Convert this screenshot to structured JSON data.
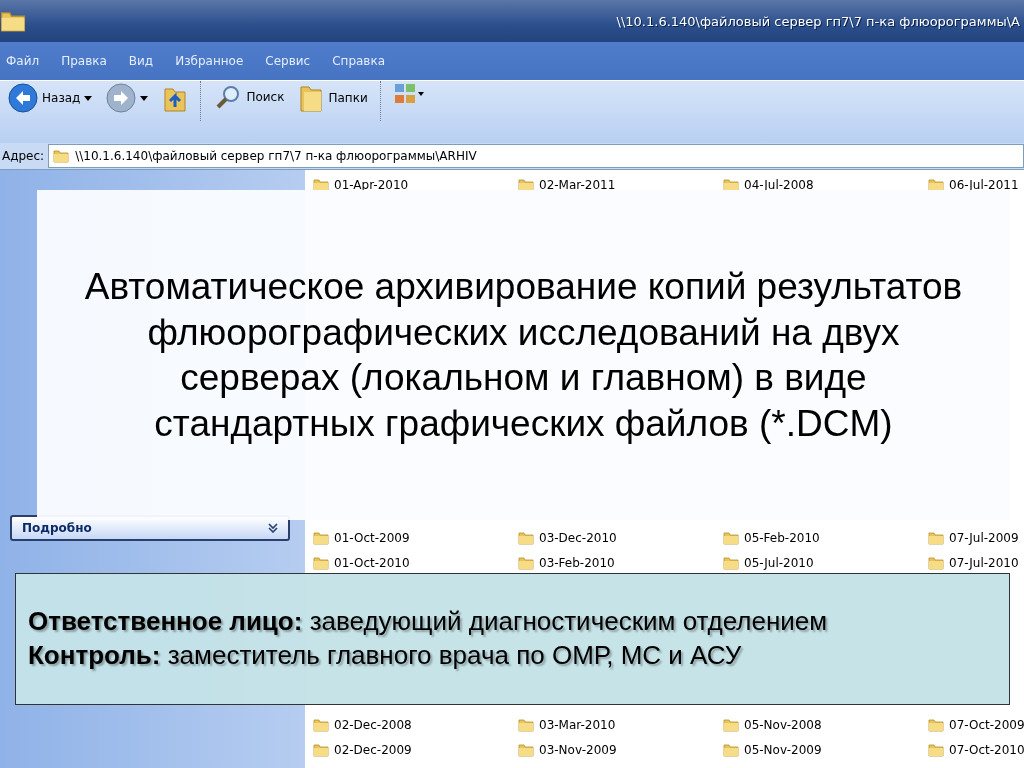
{
  "window": {
    "title": "\\\\10.1.6.140\\файловый сервер гп7\\7 п-ка флюорограммы\\А"
  },
  "menu": [
    "Файл",
    "Правка",
    "Вид",
    "Избранное",
    "Сервис",
    "Справка"
  ],
  "toolbar": [
    {
      "kind": "back",
      "label": "Назад"
    },
    {
      "kind": "forward"
    },
    {
      "kind": "up"
    },
    {
      "kind": "search",
      "label": "Поиск"
    },
    {
      "kind": "folders",
      "label": "Папки"
    },
    {
      "kind": "views"
    }
  ],
  "address": {
    "label": "Адрес:",
    "value": "\\\\10.1.6.140\\файловый сервер гп7\\7 п-ка флюорограммы\\ARHIV"
  },
  "sidebar": {
    "panels": [
      {
        "title": "Подробно",
        "expanded": false
      }
    ]
  },
  "folder_blocks": [
    [
      [
        "01-Apr-2010",
        "02-Mar-2011",
        "04-Jul-2008",
        "06-Jul-2011"
      ]
    ],
    [
      [
        "01-Oct-2009",
        "03-Dec-2010",
        "05-Feb-2010",
        "07-Jul-2009"
      ],
      [
        "01-Oct-2010",
        "03-Feb-2010",
        "05-Jul-2010",
        "07-Jul-2010"
      ]
    ],
    [
      [
        "02-Dec-2008",
        "03-Mar-2010",
        "05-Nov-2008",
        "07-Oct-2009"
      ],
      [
        "02-Dec-2009",
        "03-Nov-2009",
        "05-Nov-2009",
        "07-Oct-2010"
      ]
    ]
  ],
  "slide_title": "Автоматическое архивирование копий результатов флюорографических исследований на двух серверах (локальном и главном) в виде стандартных графических файлов (*.DCM)",
  "responsibility": [
    "**Ответственное лицо:** заведующий диагностическим отделением",
    "**Контроль:** заместитель главного врача по ОМР, МС и АСУ"
  ]
}
